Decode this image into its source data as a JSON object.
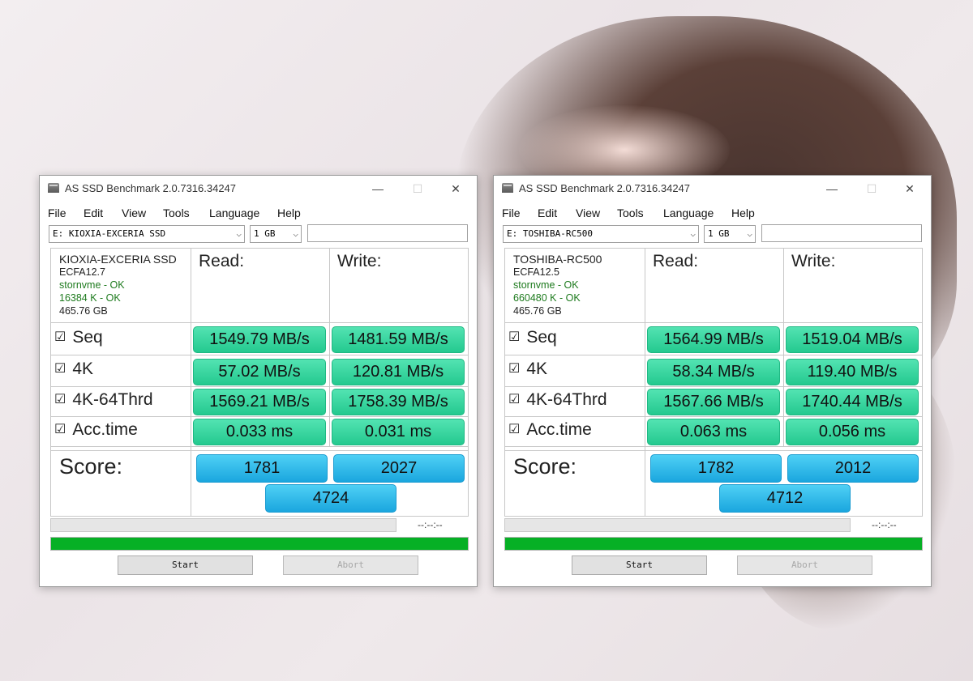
{
  "windows": [
    {
      "title": "AS SSD Benchmark 2.0.7316.34247",
      "menu": [
        "File",
        "Edit",
        "View",
        "Tools",
        "Language",
        "Help"
      ],
      "drive": "E: KIOXIA-EXCERIA SSD",
      "size": "1 GB",
      "info": {
        "name": "KIOXIA-EXCERIA SSD",
        "firmware": "ECFA12.7",
        "driver": "stornvme - OK",
        "alignment": "16384 K - OK",
        "capacity": "465.76 GB"
      },
      "headers": {
        "read": "Read:",
        "write": "Write:"
      },
      "rows": [
        {
          "label": "Seq",
          "read": "1549.79 MB/s",
          "write": "1481.59 MB/s"
        },
        {
          "label": "4K",
          "read": "57.02 MB/s",
          "write": "120.81 MB/s"
        },
        {
          "label": "4K-64Thrd",
          "read": "1569.21 MB/s",
          "write": "1758.39 MB/s"
        },
        {
          "label": "Acc.time",
          "read": "0.033 ms",
          "write": "0.031 ms"
        }
      ],
      "score_label": "Score:",
      "score": {
        "read": "1781",
        "write": "2027",
        "total": "4724"
      },
      "timer": "--:--:--",
      "progress": 1.0,
      "start_label": "Start",
      "abort_label": "Abort"
    },
    {
      "title": "AS SSD Benchmark 2.0.7316.34247",
      "menu": [
        "File",
        "Edit",
        "View",
        "Tools",
        "Language",
        "Help"
      ],
      "drive": "E: TOSHIBA-RC500",
      "size": "1 GB",
      "info": {
        "name": "TOSHIBA-RC500",
        "firmware": "ECFA12.5",
        "driver": "stornvme - OK",
        "alignment": "660480 K - OK",
        "capacity": "465.76 GB"
      },
      "headers": {
        "read": "Read:",
        "write": "Write:"
      },
      "rows": [
        {
          "label": "Seq",
          "read": "1564.99 MB/s",
          "write": "1519.04 MB/s"
        },
        {
          "label": "4K",
          "read": "58.34 MB/s",
          "write": "119.40 MB/s"
        },
        {
          "label": "4K-64Thrd",
          "read": "1567.66 MB/s",
          "write": "1740.44 MB/s"
        },
        {
          "label": "Acc.time",
          "read": "0.063 ms",
          "write": "0.056 ms"
        }
      ],
      "score_label": "Score:",
      "score": {
        "read": "1782",
        "write": "2012",
        "total": "4712"
      },
      "timer": "--:--:--",
      "progress": 1.0,
      "start_label": "Start",
      "abort_label": "Abort"
    }
  ]
}
